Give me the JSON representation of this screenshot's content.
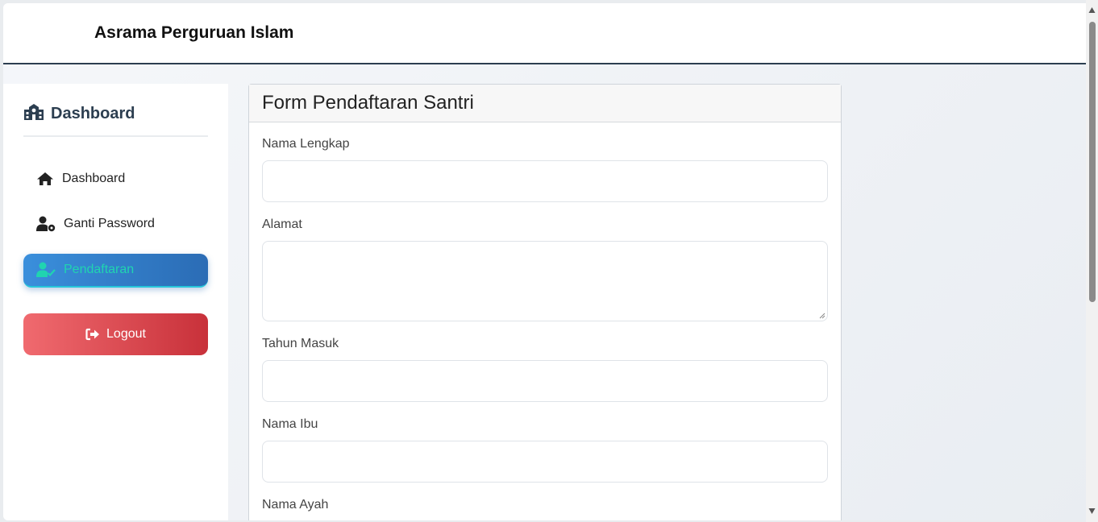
{
  "header": {
    "site_title": "Asrama Perguruan Islam"
  },
  "sidebar": {
    "title": "Dashboard",
    "title_icon": "school-icon",
    "items": [
      {
        "label": "Dashboard",
        "icon": "home-icon",
        "active": false
      },
      {
        "label": "Ganti Password",
        "icon": "user-cog-icon",
        "active": false
      },
      {
        "label": "Pendaftaran",
        "icon": "user-check-icon",
        "active": true
      }
    ],
    "logout_label": "Logout",
    "logout_icon": "sign-out-icon"
  },
  "form": {
    "title": "Form Pendaftaran Santri",
    "fields": [
      {
        "label": "Nama Lengkap",
        "value": ""
      },
      {
        "label": "Alamat",
        "value": ""
      },
      {
        "label": "Tahun Masuk",
        "value": ""
      },
      {
        "label": "Nama Ibu",
        "value": ""
      },
      {
        "label": "Nama Ayah",
        "value": ""
      }
    ]
  },
  "colors": {
    "active_gradient_start": "#3a8fdc",
    "active_gradient_end": "#2b6cb5",
    "active_text": "#20d4b0",
    "logout_gradient_start": "#f06a6f",
    "logout_gradient_end": "#c8313a",
    "header_border": "#2c3e50"
  }
}
